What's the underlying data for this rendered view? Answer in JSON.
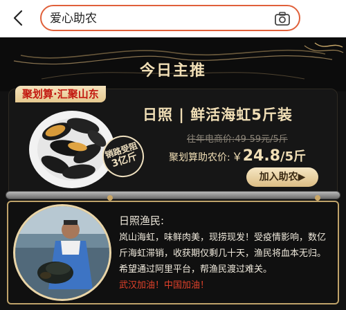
{
  "search": {
    "query": "爱心助农"
  },
  "header": {
    "title": "今日主推"
  },
  "product": {
    "tag": "聚划算·汇聚山东",
    "title": "日照 | 鲜活海虹5斤装",
    "stamp_line1": "销路受阻",
    "stamp_line2": "3亿斤",
    "old_price": "往年电商价:49-59元/5斤",
    "price_label": "聚划算助农价:",
    "price_symbol": "￥",
    "price_value": "24.8",
    "price_unit": "/5斤",
    "buy_button": "加入助农▶"
  },
  "story": {
    "title": "日照渔民:",
    "body": "岚山海虹，味鲜肉美，现捞现发！受疫情影响，数亿斤海虹滞销，收获期仅剩几十天，渔民将血本无归。希望通过阿里平台，帮渔民渡过难关。",
    "slogan": "武汉加油！中国加油！"
  },
  "colors": {
    "search_border": "#e0603a",
    "gold_text": "#f1dfb6",
    "tag_red": "#c21810",
    "slogan_red": "#e0412a",
    "panel_border": "#bfa36a"
  },
  "icons": {
    "back": "chevron-left-icon",
    "camera": "camera-icon"
  }
}
